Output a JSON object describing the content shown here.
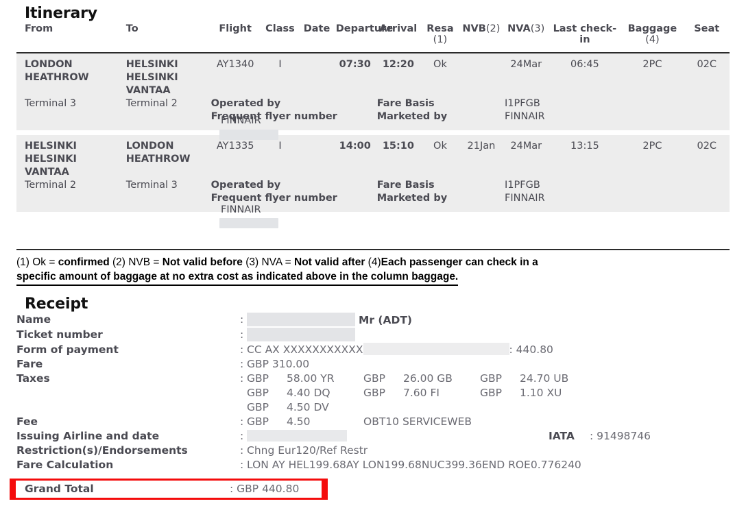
{
  "itinerary": {
    "title": "Itinerary",
    "columns": [
      {
        "label": "From",
        "note": ""
      },
      {
        "label": "To",
        "note": ""
      },
      {
        "label": "Flight",
        "note": ""
      },
      {
        "label": "Class",
        "note": ""
      },
      {
        "label": "Date",
        "note": ""
      },
      {
        "label": "Departure",
        "note": ""
      },
      {
        "label": "Arrival",
        "note": ""
      },
      {
        "label": "Resa",
        "note": "(1)"
      },
      {
        "label": "NVB",
        "note": "(2)"
      },
      {
        "label": "NVA",
        "note": "(3)"
      },
      {
        "label": "Last check-in",
        "note": ""
      },
      {
        "label": "Baggage",
        "note": "(4)"
      },
      {
        "label": "Seat",
        "note": ""
      }
    ],
    "labels": {
      "operated_by": "Operated by",
      "frequent_flyer": "Frequent flyer number",
      "fare_basis": "Fare Basis",
      "marketed_by": "Marketed by"
    },
    "segments": [
      {
        "from_city": "LONDON HEATHROW",
        "to_city": "HELSINKI HELSINKI VANTAA",
        "from_terminal": "Terminal 3",
        "to_terminal": "Terminal 2",
        "flight": "AY1340",
        "class": "I",
        "date": "",
        "departure": "07:30",
        "arrival": "12:20",
        "resa": "Ok",
        "nvb": "",
        "nva": "24Mar",
        "last_check_in": "06:45",
        "baggage": "2PC",
        "seat": "02C",
        "operated_by_value": "FINNAIR",
        "fare_basis_value": "I1PFGB",
        "marketed_by_value": "FINNAIR"
      },
      {
        "from_city": "HELSINKI HELSINKI VANTAA",
        "to_city": "LONDON HEATHROW",
        "from_terminal": "Terminal 2",
        "to_terminal": "Terminal 3",
        "flight": "AY1335",
        "class": "I",
        "date": "",
        "departure": "14:00",
        "arrival": "15:10",
        "resa": "Ok",
        "nvb": "21Jan",
        "nva": "24Mar",
        "last_check_in": "13:15",
        "baggage": "2PC",
        "seat": "02C",
        "operated_by_value": "FINNAIR",
        "fare_basis_value": "I1PFGB",
        "marketed_by_value": "FINNAIR"
      }
    ]
  },
  "legend": {
    "line1_a": "(1) Ok = ",
    "line1_b": "confirmed",
    "line1_c": " (2) NVB = ",
    "line1_d": "Not valid before",
    "line1_e": " (3) NVA = ",
    "line1_f": "Not valid after",
    "line1_g": " (4)",
    "line1_h": "Each passenger can check in a",
    "line2": "specific amount of baggage at no extra cost as indicated above in the column baggage."
  },
  "receipt": {
    "title": "Receipt",
    "rows": {
      "name_label": "Name",
      "name_suffix": "Mr (ADT)",
      "ticket_label": "Ticket number",
      "fop_label": "Form of payment",
      "fop_value": "CC AX XXXXXXXXXXX",
      "fop_amount": ": 440.80",
      "fare_label": "Fare",
      "fare_value": "GBP 310.00",
      "taxes_label": "Taxes",
      "fee_label": "Fee",
      "fee_currency": "GBP",
      "fee_amount": "4.50",
      "fee_extra": "OBT10 SERVICEWEB",
      "issuing_label": "Issuing Airline and date",
      "iata_label": "IATA",
      "iata_colon": ":",
      "iata_value": "91498746",
      "restrictions_label": "Restriction(s)/Endorsements",
      "restrictions_value": "Chng Eur120/Ref Restr",
      "farecalc_label": "Fare Calculation",
      "farecalc_value": "LON AY HEL199.68AY LON199.68NUC399.36END ROE0.776240"
    },
    "taxes": [
      [
        {
          "cur": "GBP",
          "amt": "58.00 YR"
        },
        {
          "cur": "GBP",
          "amt": "26.00 GB"
        },
        {
          "cur": "GBP",
          "amt": "24.70 UB"
        }
      ],
      [
        {
          "cur": "GBP",
          "amt": "4.40 DQ"
        },
        {
          "cur": "GBP",
          "amt": "7.60 FI"
        },
        {
          "cur": "GBP",
          "amt": "1.10 XU"
        }
      ],
      [
        {
          "cur": "GBP",
          "amt": "4.50 DV"
        }
      ]
    ],
    "grand_total": {
      "label": "Grand Total",
      "value": ": GBP 440.80",
      "highlight_color": "#f40c0c"
    }
  }
}
